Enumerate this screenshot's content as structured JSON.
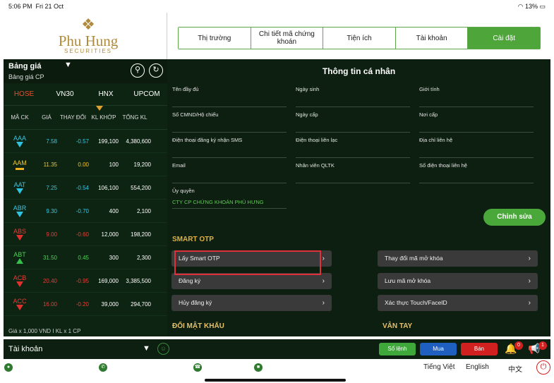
{
  "status_bar": {
    "time": "5:06 PM",
    "date": "Fri 21 Oct",
    "battery": "13%"
  },
  "brand": {
    "name": "Phu Hung",
    "tagline": "SECURITIES"
  },
  "nav_tabs": [
    {
      "label": "Thị trường"
    },
    {
      "label": "Chi tiết mã chứng khoán"
    },
    {
      "label": "Tiện ích"
    },
    {
      "label": "Tài khoản"
    },
    {
      "label": "Cài đặt",
      "active": true
    }
  ],
  "market": {
    "title": "Bảng giá",
    "subtitle": "Bảng giá CP",
    "exchanges": [
      "HOSE",
      "VN30",
      "HNX",
      "UPCOM"
    ],
    "active_exchange": "HOSE",
    "columns": [
      "MÃ CK",
      "GIÁ",
      "THAY ĐỔI",
      "KL KHỚP",
      "TỔNG KL"
    ],
    "rows": [
      {
        "code": "AAA",
        "price": "7.58",
        "change": "-0.57",
        "volume": "199,100",
        "total": "4,380,600",
        "dir": "down-cyan"
      },
      {
        "code": "AAM",
        "price": "11.35",
        "change": "0.00",
        "volume": "100",
        "total": "19,200",
        "dir": "flat"
      },
      {
        "code": "AAT",
        "price": "7.25",
        "change": "-0.54",
        "volume": "106,100",
        "total": "554,200",
        "dir": "down-cyan"
      },
      {
        "code": "ABR",
        "price": "9.30",
        "change": "-0.70",
        "volume": "400",
        "total": "2,100",
        "dir": "down-cyan"
      },
      {
        "code": "ABS",
        "price": "9.00",
        "change": "-0.60",
        "volume": "12,000",
        "total": "198,200",
        "dir": "down-red"
      },
      {
        "code": "ABT",
        "price": "31.50",
        "change": "0.45",
        "volume": "300",
        "total": "2,300",
        "dir": "up"
      },
      {
        "code": "ACB",
        "price": "20.40",
        "change": "-0.95",
        "volume": "169,000",
        "total": "3,385,500",
        "dir": "down-red"
      },
      {
        "code": "ACC",
        "price": "16.00",
        "change": "-0.20",
        "volume": "39,000",
        "total": "294,700",
        "dir": "down-red"
      }
    ],
    "footnote": "Giá x 1,000 VND I KL x 1 CP"
  },
  "personal_info": {
    "title": "Thông tin cá nhân",
    "fields": [
      {
        "label": "Tên đầy đủ",
        "value": ""
      },
      {
        "label": "Ngày sinh",
        "value": ""
      },
      {
        "label": "Giới tính",
        "value": ""
      },
      {
        "label": "Số CMND/Hộ chiếu",
        "value": ""
      },
      {
        "label": "Ngày cấp",
        "value": ""
      },
      {
        "label": "Nơi cấp",
        "value": ""
      },
      {
        "label": "Điện thoại đăng ký nhận SMS",
        "value": ""
      },
      {
        "label": "Điện thoại liên lạc",
        "value": ""
      },
      {
        "label": "Địa chỉ liên hệ",
        "value": ""
      },
      {
        "label": "Email",
        "value": ""
      },
      {
        "label": "Nhân viên QLTK",
        "value": ""
      },
      {
        "label": "Số điện thoại liên hệ",
        "value": ""
      },
      {
        "label": "Ủy quyền",
        "value": "CTY CP CHỨNG KHOÁN PHÚ HƯNG"
      }
    ],
    "edit_label": "Chỉnh sửa"
  },
  "smart_otp": {
    "title": "SMART OTP",
    "left_buttons": [
      "Lấy Smart OTP",
      "Đăng ký",
      "Hủy đăng ký"
    ],
    "right_buttons": [
      "Thay đổi mã mở khóa",
      "Lưu mã mở khóa",
      "Xác thực Touch/FaceID"
    ]
  },
  "sections": {
    "change_password": "ĐỔI MẬT KHẨU",
    "fingerprint": "VÂN TAY"
  },
  "bottom_bar": {
    "account_label": "Tài khoản",
    "order_book": "Sổ lệnh",
    "buy": "Mua",
    "sell": "Bán",
    "bell_badge": "0",
    "megaphone_badge": "1"
  },
  "languages": [
    "Tiếng Việt",
    "English",
    "中文"
  ],
  "colors": {
    "accent": "#4ea53a",
    "highlight": "#e0303a",
    "buy": "#1f5fbf",
    "sell": "#d02020"
  }
}
